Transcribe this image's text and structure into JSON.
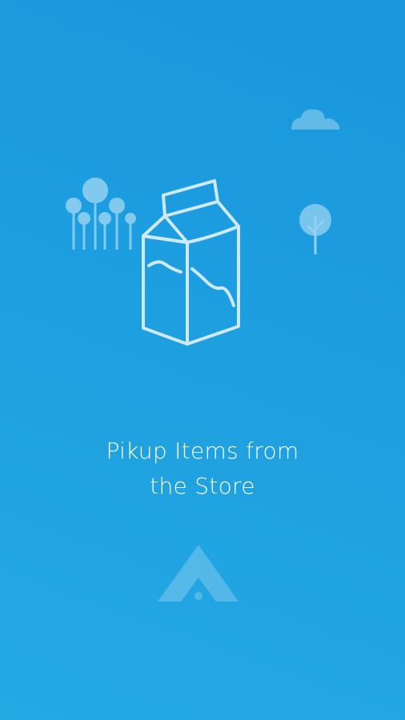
{
  "onboarding": {
    "title_line1": "Pikup Items from",
    "title_line2": "the Store"
  },
  "icons": {
    "cloud": "cloud-icon",
    "forest": "trees-icon",
    "tree": "tree-icon",
    "milk": "milk-carton-icon",
    "logo": "app-logo-icon"
  },
  "colors": {
    "background_top": "#1a96dc",
    "background_bottom": "#25a9e3",
    "line_art": "#cfe9f8",
    "text": "#ffffff"
  }
}
